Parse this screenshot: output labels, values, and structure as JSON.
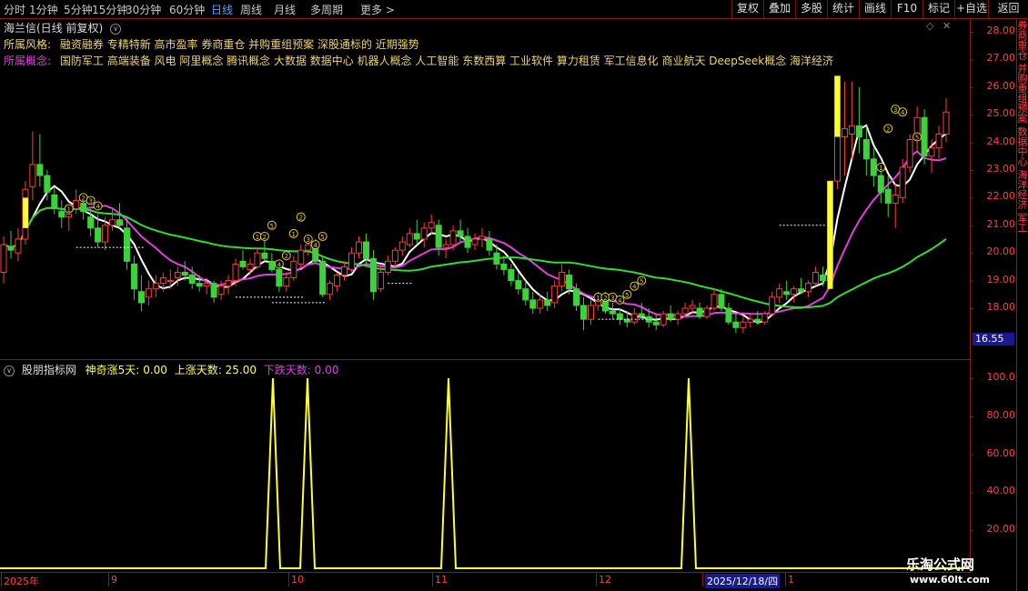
{
  "toolbar": {
    "timeframes": [
      "分时",
      "1分钟",
      "5分钟",
      "15分钟",
      "30分钟",
      "60分钟",
      "日线",
      "周线",
      "月线",
      "多周期",
      "更多"
    ],
    "active_timeframe": "日线",
    "right_buttons": [
      "复权",
      "叠加",
      "多股",
      "统计",
      "画线",
      "F10",
      "标记",
      "+自选",
      "返回"
    ]
  },
  "stock": {
    "title": "海兰信(日线 前复权)"
  },
  "style_row": {
    "label": "所属风格:",
    "text": "融资融券 专精特新 高市盈率 券商重仓 并购重组预案 深股通标的 近期强势"
  },
  "concept_row": {
    "label": "所属概念:",
    "text": "国防军工 高端装备 风电 阿里概念 腾讯概念 大数据 数据中心 机器人概念 人工智能 东数西算 工业软件 算力租赁 军工信息化 商业航天 DeepSeek概念 海洋经济"
  },
  "price_axis": [
    "28.00",
    "27.00",
    "26.00",
    "25.00",
    "24.00",
    "23.00",
    "22.00",
    "21.00",
    "20.00",
    "19.00",
    "18.00"
  ],
  "last_price": "16.55",
  "indicator": {
    "name": "股朋指标网",
    "v1_label": "神奇涨5天:",
    "v1": "0.00",
    "v2_label": "上涨天数:",
    "v2": "25.00",
    "v3_label": "下跌天数:",
    "v3": "0.00",
    "axis": [
      "100.0",
      "80.00",
      "60.00",
      "40.00",
      "20.00"
    ]
  },
  "x_axis": {
    "labels": [
      "2025年",
      "9",
      "10",
      "11",
      "12",
      "2025/12/18/四",
      "1"
    ]
  },
  "watermark": {
    "site": "乐淘公式网",
    "url": "www.60lt.com"
  },
  "side_text": "券商重仓 并购重组预案 数据中心 海洋经济 军工",
  "colors": {
    "up": "#ff3c3c",
    "down": "#3cd23c",
    "ma_white": "#ffffff",
    "ma_purple": "#e040e0",
    "ma_green": "#30dd30",
    "signal": "#ffff30",
    "frame": "#8b1a1a"
  },
  "chart_data": {
    "type": "candlestick",
    "ylim": [
      16.55,
      28.5
    ],
    "candles": [
      [
        19.3,
        20.6,
        18.9,
        20.3
      ],
      [
        20.2,
        20.8,
        19.8,
        20.1
      ],
      [
        20.0,
        20.9,
        19.7,
        20.5
      ],
      [
        20.5,
        22.6,
        20.3,
        22.3
      ],
      [
        22.4,
        24.4,
        21.9,
        23.2
      ],
      [
        23.2,
        24.3,
        22.4,
        22.8
      ],
      [
        22.8,
        23.0,
        21.9,
        22.2
      ],
      [
        22.1,
        22.4,
        21.4,
        21.6
      ],
      [
        21.5,
        21.9,
        20.9,
        21.3
      ],
      [
        21.3,
        21.6,
        20.8,
        21.4
      ],
      [
        21.6,
        22.3,
        21.4,
        21.9
      ],
      [
        21.8,
        22.1,
        21.2,
        21.5
      ],
      [
        21.3,
        21.6,
        20.6,
        20.9
      ],
      [
        20.9,
        21.4,
        20.2,
        20.4
      ],
      [
        20.4,
        21.3,
        20.1,
        21.0
      ],
      [
        21.0,
        21.6,
        20.8,
        21.2
      ],
      [
        21.2,
        21.8,
        20.9,
        21.0
      ],
      [
        20.9,
        21.3,
        19.4,
        19.7
      ],
      [
        19.6,
        19.9,
        18.3,
        18.7
      ],
      [
        18.6,
        19.2,
        17.9,
        18.2
      ],
      [
        18.4,
        19.0,
        18.1,
        18.7
      ],
      [
        18.7,
        19.2,
        18.4,
        18.9
      ],
      [
        18.9,
        19.3,
        18.6,
        19.1
      ],
      [
        19.0,
        19.4,
        18.7,
        19.0
      ],
      [
        19.1,
        19.5,
        18.8,
        19.3
      ],
      [
        19.3,
        19.7,
        19.0,
        19.2
      ],
      [
        19.2,
        19.5,
        18.7,
        18.9
      ],
      [
        18.9,
        19.2,
        18.6,
        18.8
      ],
      [
        18.8,
        19.1,
        18.5,
        18.9
      ],
      [
        18.9,
        19.0,
        18.2,
        18.4
      ],
      [
        18.5,
        19.0,
        18.3,
        18.8
      ],
      [
        18.8,
        19.2,
        18.5,
        19.0
      ],
      [
        19.0,
        19.8,
        18.8,
        19.6
      ],
      [
        19.7,
        20.1,
        19.4,
        19.5
      ],
      [
        19.4,
        19.8,
        19.2,
        19.6
      ],
      [
        19.5,
        20.2,
        19.4,
        20.0
      ],
      [
        20.0,
        20.6,
        19.7,
        19.8
      ],
      [
        19.7,
        20.0,
        19.3,
        19.4
      ],
      [
        19.4,
        19.7,
        18.6,
        18.8
      ],
      [
        18.8,
        19.3,
        18.6,
        19.1
      ],
      [
        19.1,
        19.9,
        19.0,
        19.7
      ],
      [
        19.6,
        20.3,
        19.5,
        20.1
      ],
      [
        20.1,
        20.6,
        19.9,
        20.3
      ],
      [
        20.3,
        20.5,
        19.6,
        19.7
      ],
      [
        19.7,
        19.9,
        18.4,
        18.5
      ],
      [
        18.5,
        19.0,
        18.3,
        18.9
      ],
      [
        18.8,
        19.3,
        18.6,
        19.2
      ],
      [
        19.2,
        19.7,
        19.0,
        19.5
      ],
      [
        19.4,
        20.2,
        19.3,
        20.0
      ],
      [
        20.0,
        20.6,
        19.8,
        20.4
      ],
      [
        20.4,
        20.7,
        19.6,
        19.8
      ],
      [
        19.8,
        20.1,
        18.3,
        18.6
      ],
      [
        18.7,
        19.5,
        18.6,
        19.3
      ],
      [
        19.3,
        19.9,
        19.2,
        19.7
      ],
      [
        19.7,
        20.2,
        19.5,
        20.1
      ],
      [
        20.1,
        20.6,
        19.9,
        20.4
      ],
      [
        20.3,
        20.9,
        20.2,
        20.7
      ],
      [
        20.7,
        21.2,
        20.3,
        20.5
      ],
      [
        20.5,
        21.1,
        20.2,
        20.9
      ],
      [
        20.9,
        21.4,
        20.7,
        21.1
      ],
      [
        21.0,
        21.2,
        19.9,
        20.2
      ],
      [
        20.2,
        20.5,
        19.8,
        20.3
      ],
      [
        20.3,
        21.0,
        20.1,
        20.8
      ],
      [
        20.8,
        21.2,
        20.4,
        20.6
      ],
      [
        20.6,
        20.9,
        20.0,
        20.2
      ],
      [
        20.3,
        20.7,
        20.1,
        20.5
      ],
      [
        20.5,
        20.9,
        20.2,
        20.6
      ],
      [
        20.5,
        20.8,
        19.9,
        20.1
      ],
      [
        20.0,
        20.3,
        19.4,
        19.6
      ],
      [
        19.6,
        19.9,
        19.2,
        19.4
      ],
      [
        19.4,
        19.6,
        18.8,
        19.0
      ],
      [
        19.0,
        19.3,
        18.5,
        18.7
      ],
      [
        18.7,
        19.0,
        18.1,
        18.3
      ],
      [
        18.3,
        18.6,
        17.8,
        18.0
      ],
      [
        18.0,
        18.5,
        17.8,
        18.3
      ],
      [
        18.3,
        18.6,
        17.9,
        18.1
      ],
      [
        18.2,
        19.0,
        18.0,
        18.8
      ],
      [
        18.8,
        19.6,
        18.6,
        19.3
      ],
      [
        19.2,
        19.4,
        18.5,
        18.7
      ],
      [
        18.7,
        18.9,
        17.9,
        18.1
      ],
      [
        18.1,
        18.4,
        17.2,
        17.6
      ],
      [
        17.6,
        18.3,
        17.4,
        18.1
      ],
      [
        18.1,
        18.6,
        17.9,
        18.4
      ],
      [
        18.4,
        18.6,
        17.8,
        17.9
      ],
      [
        17.9,
        18.2,
        17.6,
        17.8
      ],
      [
        17.8,
        18.0,
        17.4,
        17.6
      ],
      [
        17.6,
        17.9,
        17.3,
        17.5
      ],
      [
        17.5,
        18.0,
        17.4,
        17.8
      ],
      [
        17.8,
        18.2,
        17.6,
        17.7
      ],
      [
        17.7,
        18.0,
        17.3,
        17.5
      ],
      [
        17.5,
        17.8,
        17.2,
        17.4
      ],
      [
        17.4,
        17.9,
        17.3,
        17.8
      ],
      [
        17.8,
        18.1,
        17.5,
        17.6
      ],
      [
        17.6,
        17.9,
        17.4,
        17.8
      ],
      [
        17.8,
        18.2,
        17.7,
        18.0
      ],
      [
        18.0,
        18.3,
        17.8,
        18.1
      ],
      [
        18.0,
        18.2,
        17.6,
        17.7
      ],
      [
        17.7,
        18.1,
        17.6,
        18.0
      ],
      [
        18.0,
        18.7,
        17.9,
        18.5
      ],
      [
        18.5,
        18.7,
        17.9,
        18.0
      ],
      [
        18.0,
        18.2,
        17.4,
        17.5
      ],
      [
        17.5,
        17.8,
        17.1,
        17.3
      ],
      [
        17.3,
        17.7,
        17.1,
        17.5
      ],
      [
        17.5,
        17.8,
        17.3,
        17.6
      ],
      [
        17.6,
        17.9,
        17.4,
        17.5
      ],
      [
        17.5,
        17.9,
        17.4,
        17.8
      ],
      [
        17.8,
        18.6,
        17.7,
        18.4
      ],
      [
        18.4,
        18.9,
        18.2,
        18.7
      ],
      [
        18.6,
        19.0,
        18.3,
        18.5
      ],
      [
        18.5,
        18.8,
        18.2,
        18.7
      ],
      [
        18.7,
        19.1,
        18.5,
        18.6
      ],
      [
        18.6,
        19.0,
        18.4,
        18.9
      ],
      [
        18.9,
        19.5,
        18.8,
        19.3
      ],
      [
        19.2,
        19.5,
        18.8,
        19.0
      ],
      [
        19.0,
        22.6,
        18.9,
        22.6
      ],
      [
        22.6,
        26.4,
        22.3,
        26.4
      ],
      [
        24.2,
        26.2,
        22.8,
        24.5
      ],
      [
        24.3,
        26.2,
        23.4,
        24.6
      ],
      [
        24.6,
        26.0,
        23.6,
        24.2
      ],
      [
        24.1,
        24.6,
        22.8,
        23.4
      ],
      [
        23.4,
        23.8,
        22.4,
        22.8
      ],
      [
        22.8,
        23.2,
        21.8,
        22.2
      ],
      [
        22.3,
        22.8,
        21.3,
        21.8
      ],
      [
        21.8,
        22.5,
        20.9,
        22.1
      ],
      [
        22.0,
        23.4,
        21.8,
        23.1
      ],
      [
        23.1,
        24.3,
        22.9,
        24.1
      ],
      [
        24.1,
        25.3,
        23.7,
        24.9
      ],
      [
        24.9,
        25.2,
        23.2,
        23.5
      ],
      [
        23.5,
        24.1,
        22.9,
        23.8
      ],
      [
        23.8,
        24.6,
        23.4,
        24.3
      ],
      [
        24.3,
        25.6,
        24.0,
        25.1
      ]
    ],
    "ma_note": "white, purple, green moving averages",
    "indicator_spikes_idx": [
      33,
      38,
      63,
      103
    ]
  }
}
